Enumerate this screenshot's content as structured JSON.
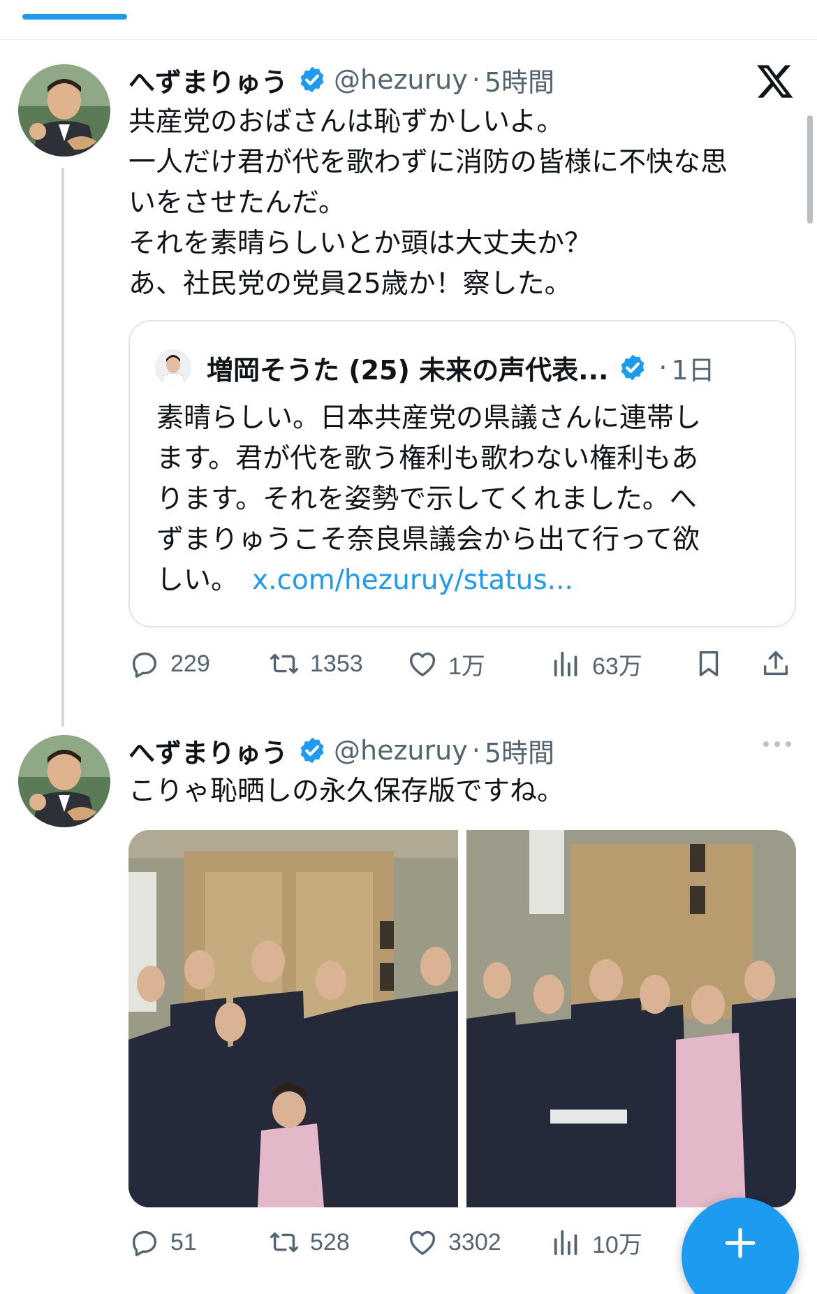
{
  "tweet1": {
    "display_name": "へずまりゅう",
    "handle": "@hezuruy",
    "dot": "·",
    "time": "5時間",
    "lines": [
      "共産党のおばさんは恥ずかしいよ。",
      "一人だけ君が代を歌わずに消防の皆様に不快な思",
      "いをさせたんだ。",
      "それを素晴らしいとか頭は大丈夫か？",
      "あ、社民党の党員25歳か！察した。"
    ],
    "quote": {
      "display_name": "増岡そうた (25) 未来の声代表...",
      "dot": "·",
      "time": "1日",
      "lines": [
        "素晴らしい。日本共産党の県議さんに連帯し",
        "ます。君が代を歌う権利も歌わない権利もあ",
        "ります。それを姿勢で示してくれました。へ",
        "ずまりゅうこそ奈良県議会から出て行って欲"
      ],
      "last_line": "しい。",
      "link": "x.com/hezuruy/status..."
    },
    "actions": {
      "replies": "229",
      "reposts": "1353",
      "likes": "1万",
      "views": "63万"
    }
  },
  "tweet2": {
    "display_name": "へずまりゅう",
    "handle": "@hezuruy",
    "dot": "·",
    "time": "5時間",
    "text": "こりゃ恥晒しの永久保存版ですね。",
    "actions": {
      "replies": "51",
      "reposts": "528",
      "likes": "3302",
      "views": "10万"
    }
  },
  "icons": {
    "verified": "verified-badge-icon",
    "x_logo": "x-logo-icon",
    "more": "more-icon",
    "reply": "reply-icon",
    "repost": "repost-icon",
    "like": "heart-icon",
    "views": "views-icon",
    "bookmark": "bookmark-icon",
    "share": "share-icon",
    "compose": "plus-icon"
  },
  "colors": {
    "accent": "#1d9bf0",
    "secondary_text": "#536471",
    "primary_text": "#0f1419"
  }
}
